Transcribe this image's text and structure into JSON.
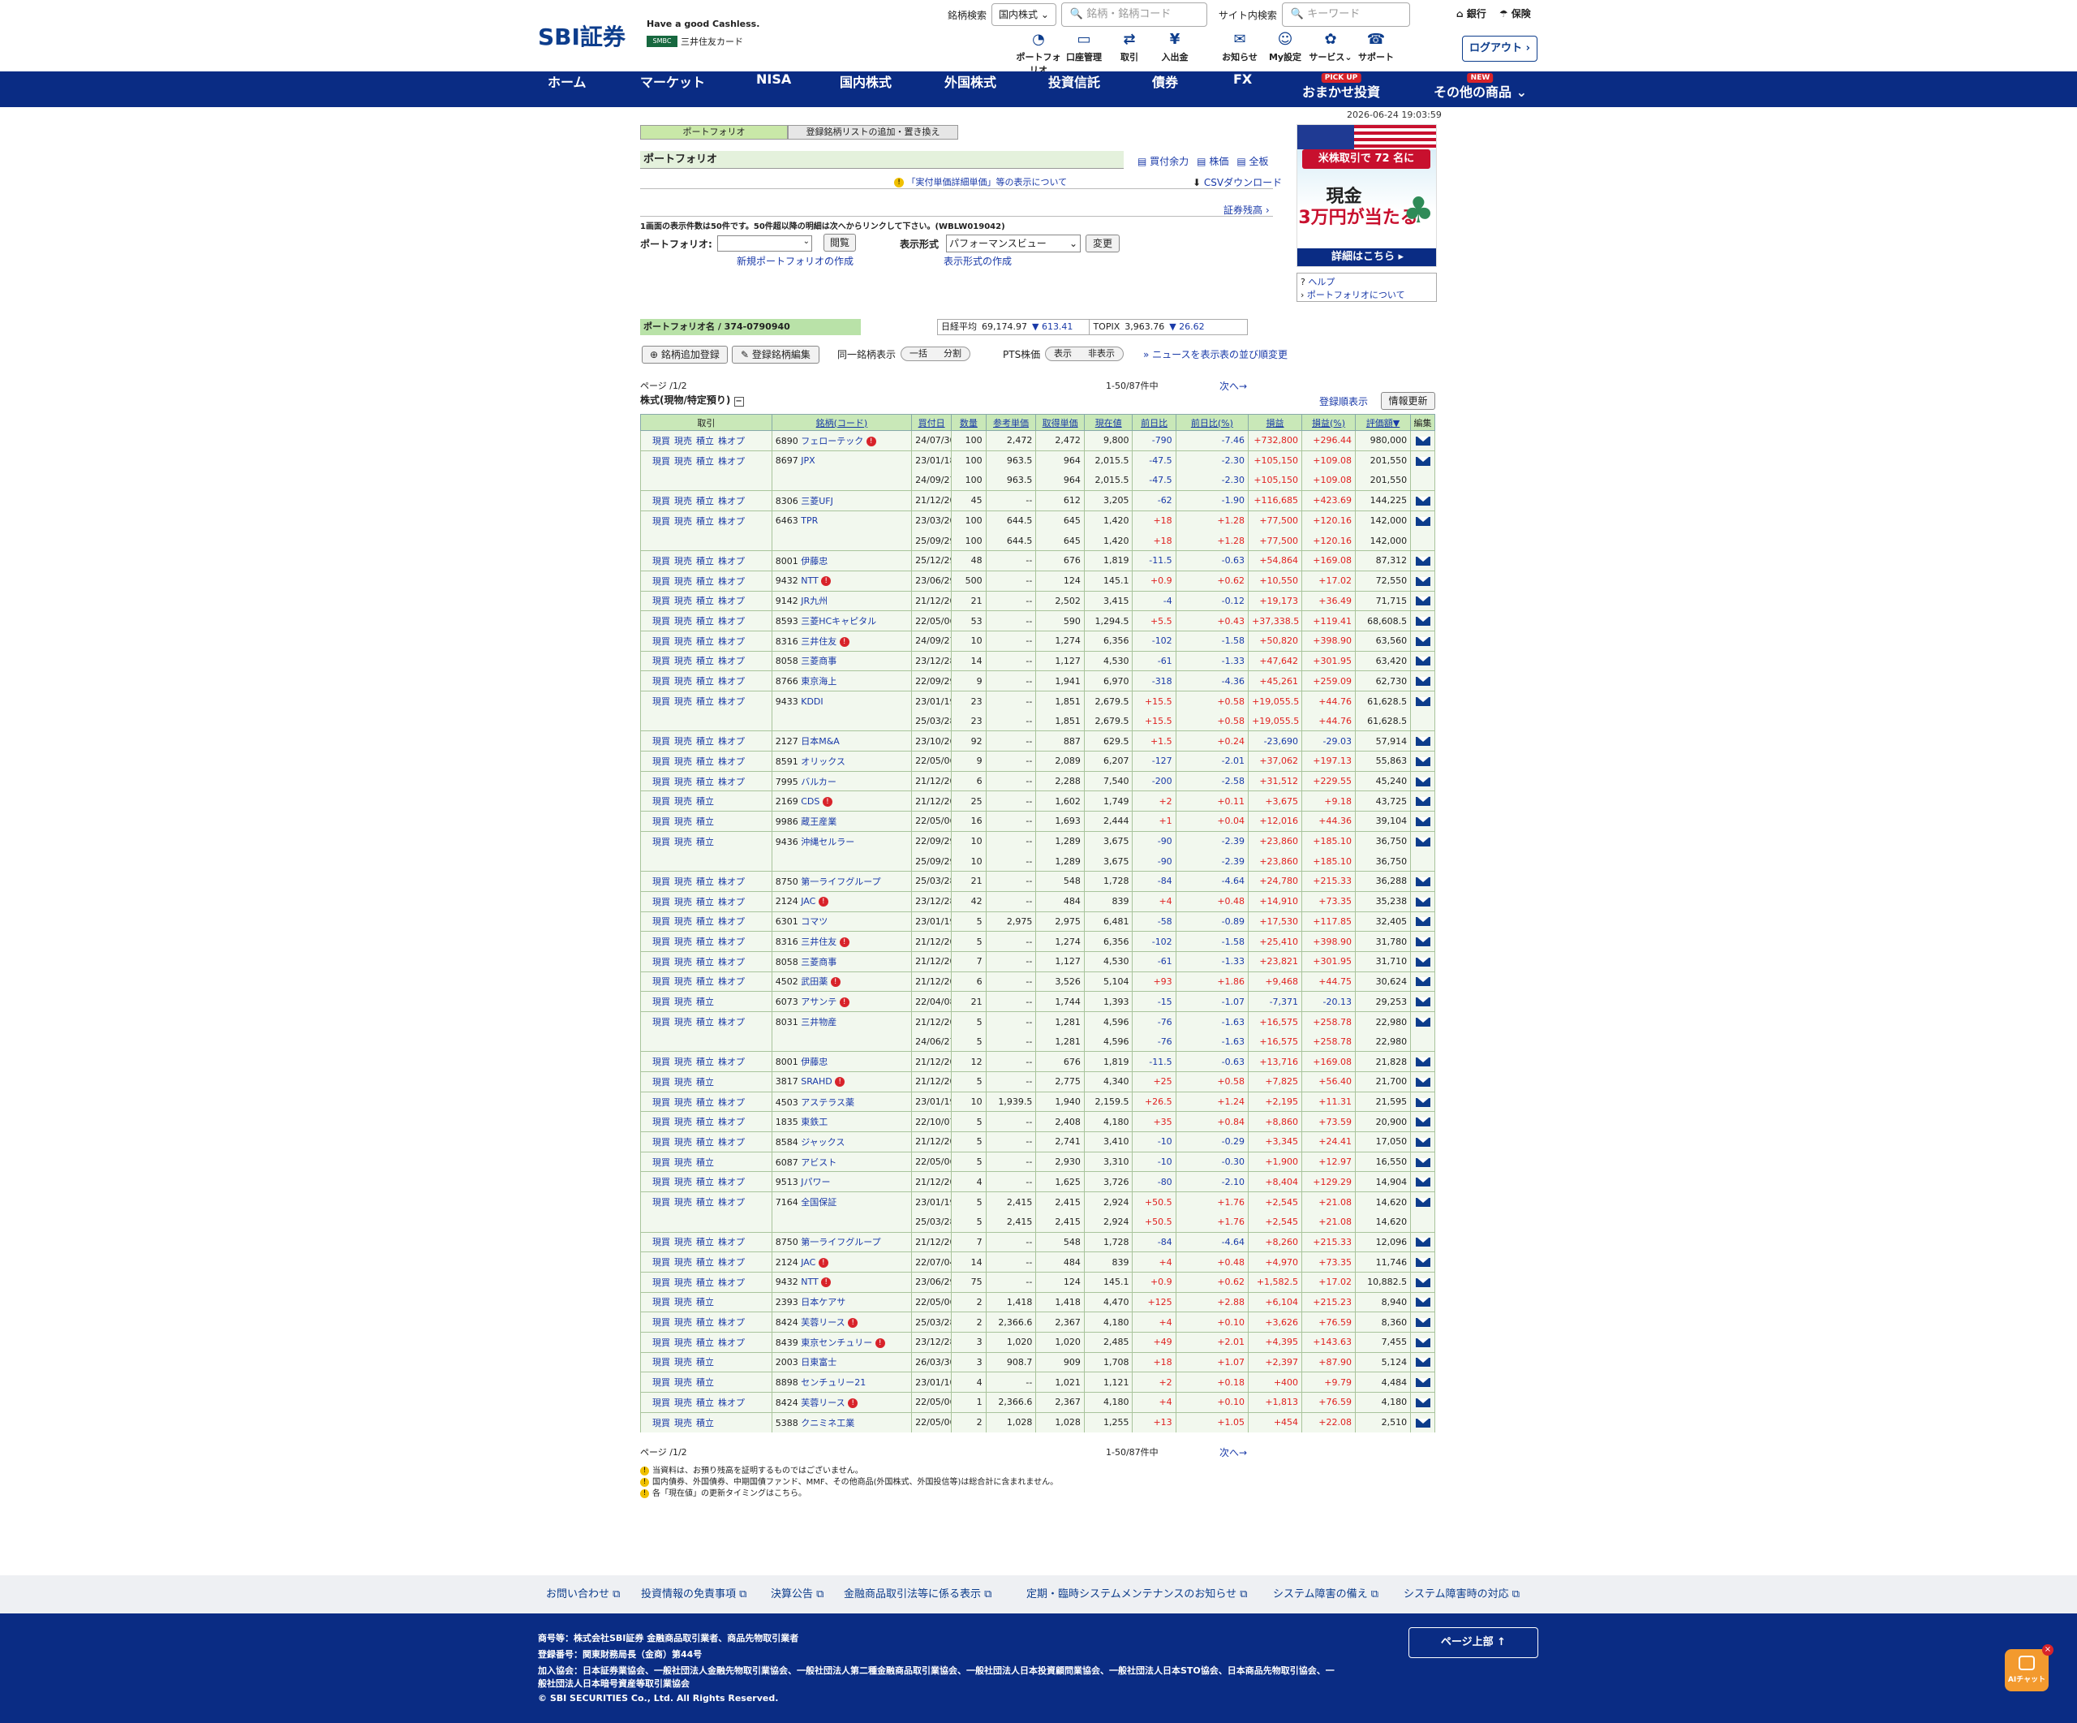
{
  "header": {
    "logo": "SBI証券",
    "tagline": "Have a good Cashless.",
    "card_badge": "SMBC",
    "card_name": "三井住友カード",
    "search_label": "銘柄検索",
    "market_select": "国内株式 ⌄",
    "stock_search_placeholder": "銘柄・銘柄コード",
    "site_search_label": "サイト内検索",
    "site_search_placeholder": "キーワード",
    "bank": "銀行",
    "insurance": "保険",
    "logout": "ログアウト ›"
  },
  "icon_nav": [
    {
      "icon": "◔",
      "label": "ポートフォリオ"
    },
    {
      "icon": "▭",
      "label": "口座管理"
    },
    {
      "icon": "⇄",
      "label": "取引"
    },
    {
      "icon": "¥",
      "label": "入出金"
    },
    {
      "icon": "✉",
      "label": "お知らせ"
    },
    {
      "icon": "☺",
      "label": "My設定"
    },
    {
      "icon": "✿",
      "label": "サービス⌄"
    },
    {
      "icon": "☎",
      "label": "サポート"
    }
  ],
  "global_nav": [
    {
      "label": "ホーム",
      "badge": ""
    },
    {
      "label": "マーケット",
      "badge": ""
    },
    {
      "label": "NISA",
      "badge": ""
    },
    {
      "label": "国内株式",
      "badge": ""
    },
    {
      "label": "外国株式",
      "badge": ""
    },
    {
      "label": "投資信託",
      "badge": ""
    },
    {
      "label": "債券",
      "badge": ""
    },
    {
      "label": "FX",
      "badge": ""
    },
    {
      "label": "おまかせ投資",
      "badge": "PICK UP"
    },
    {
      "label": "その他の商品 ⌄",
      "badge": "NEW"
    }
  ],
  "timestamp": "2026-06-24 19:03:59",
  "tabs": [
    "ポートフォリオ",
    "登録銘柄リストの追加・置き換え"
  ],
  "portfolio": {
    "title": "ポートフォリオ",
    "links": [
      "買付余力",
      "株価",
      "全板"
    ],
    "info_link": "「実付単価詳細単価」等の表示について",
    "csv": "CSVダウンロード",
    "shoken": "証券残高 ›",
    "note": "1画面の表示件数は50件です。50件超以降の明細は次へからリンクして下さい。(WBLW019042)",
    "pf_label": "ポートフォリオ:",
    "open_btn": "閲覧",
    "view_label": "表示形式",
    "view_value": "パフォーマンスビュー",
    "change_btn": "変更",
    "new_pf": "新規ポートフォリオの作成",
    "view_create": "表示形式の作成",
    "pf_name": "ポートフォリオ名 / 374-0790940"
  },
  "indices": {
    "n225_label": "日経平均",
    "n225": "69,174.97",
    "n225_chg": "▼ 613.41",
    "topix_label": "TOPIX",
    "topix": "3,963.76",
    "topix_chg": "▼ 26.62"
  },
  "controls": {
    "add": "銘柄追加登録",
    "edit": "登録銘柄編集",
    "same_label": "同一銘柄表示",
    "same_a": "一括",
    "same_b": "分割",
    "pts_label": "PTS株価",
    "pts_a": "表示",
    "pts_b": "非表示",
    "news": "ニュースを表示",
    "order": "表の並び順変更"
  },
  "ad": {
    "line1": "米株取引で 72 名に",
    "line2": "現金",
    "line3": "3万円が当たる",
    "cta": "詳細はこちら ▸"
  },
  "help": {
    "help": "ヘルプ",
    "about": "ポートフォリオについて"
  },
  "paging": {
    "page": "ページ /1/2",
    "count": "1-50/87件中",
    "next": "次へ→"
  },
  "section_title": "株式(現物/特定預り)",
  "reg_order": "登録順表示",
  "refresh": "情報更新",
  "columns": [
    "取引",
    "銘柄(コード)",
    "買付日",
    "数量",
    "参考単価",
    "取得単価",
    "現在値",
    "前日比",
    "前日比(%)",
    "損益",
    "損益(%)",
    "評価額▼",
    "編集"
  ],
  "actions": [
    "現買",
    "現売",
    "積立",
    "株オプ"
  ],
  "rows": [
    [
      "1111",
      "6890",
      "フェローテック",
      "1",
      "24/07/30",
      "100",
      "2,472",
      "2,472",
      "9,800",
      "-790",
      "-7.46",
      "+732,800",
      "+296.44",
      "980,000"
    ],
    [
      "1111",
      "8697",
      "JPX",
      "0",
      "23/01/18",
      "100",
      "963.5",
      "964",
      "2,015.5",
      "-47.5",
      "-2.30",
      "+105,150",
      "+109.08",
      "201,550"
    ],
    [
      "",
      "",
      "",
      "0",
      "24/09/27",
      "100",
      "963.5",
      "964",
      "2,015.5",
      "-47.5",
      "-2.30",
      "+105,150",
      "+109.08",
      "201,550"
    ],
    [
      "1111",
      "8306",
      "三菱UFJ",
      "0",
      "21/12/20",
      "45",
      "--",
      "612",
      "3,205",
      "-62",
      "-1.90",
      "+116,685",
      "+423.69",
      "144,225"
    ],
    [
      "1111",
      "6463",
      "TPR",
      "0",
      "23/03/20",
      "100",
      "644.5",
      "645",
      "1,420",
      "+18",
      "+1.28",
      "+77,500",
      "+120.16",
      "142,000"
    ],
    [
      "",
      "",
      "",
      "0",
      "25/09/29",
      "100",
      "644.5",
      "645",
      "1,420",
      "+18",
      "+1.28",
      "+77,500",
      "+120.16",
      "142,000"
    ],
    [
      "1111",
      "8001",
      "伊藤忠",
      "0",
      "25/12/29",
      "48",
      "--",
      "676",
      "1,819",
      "-11.5",
      "-0.63",
      "+54,864",
      "+169.08",
      "87,312"
    ],
    [
      "1111",
      "9432",
      "NTT",
      "1",
      "23/06/29",
      "500",
      "--",
      "124",
      "145.1",
      "+0.9",
      "+0.62",
      "+10,550",
      "+17.02",
      "72,550"
    ],
    [
      "1111",
      "9142",
      "JR九州",
      "0",
      "21/12/20",
      "21",
      "--",
      "2,502",
      "3,415",
      "-4",
      "-0.12",
      "+19,173",
      "+36.49",
      "71,715"
    ],
    [
      "1111",
      "8593",
      "三菱HCキャピタル",
      "0",
      "22/05/06",
      "53",
      "--",
      "590",
      "1,294.5",
      "+5.5",
      "+0.43",
      "+37,338.5",
      "+119.41",
      "68,608.5"
    ],
    [
      "1111",
      "8316",
      "三井住友",
      "1",
      "24/09/27",
      "10",
      "--",
      "1,274",
      "6,356",
      "-102",
      "-1.58",
      "+50,820",
      "+398.90",
      "63,560"
    ],
    [
      "1111",
      "8058",
      "三菱商事",
      "0",
      "23/12/28",
      "14",
      "--",
      "1,127",
      "4,530",
      "-61",
      "-1.33",
      "+47,642",
      "+301.95",
      "63,420"
    ],
    [
      "1111",
      "8766",
      "東京海上",
      "0",
      "22/09/29",
      "9",
      "--",
      "1,941",
      "6,970",
      "-318",
      "-4.36",
      "+45,261",
      "+259.09",
      "62,730"
    ],
    [
      "1111",
      "9433",
      "KDDI",
      "0",
      "23/01/19",
      "23",
      "--",
      "1,851",
      "2,679.5",
      "+15.5",
      "+0.58",
      "+19,055.5",
      "+44.76",
      "61,628.5"
    ],
    [
      "",
      "",
      "",
      "0",
      "25/03/28",
      "23",
      "--",
      "1,851",
      "2,679.5",
      "+15.5",
      "+0.58",
      "+19,055.5",
      "+44.76",
      "61,628.5"
    ],
    [
      "1111",
      "2127",
      "日本M&A",
      "0",
      "23/10/26",
      "92",
      "--",
      "887",
      "629.5",
      "+1.5",
      "+0.24",
      "-23,690",
      "-29.03",
      "57,914"
    ],
    [
      "1111",
      "8591",
      "オリックス",
      "0",
      "22/05/06",
      "9",
      "--",
      "2,089",
      "6,207",
      "-127",
      "-2.01",
      "+37,062",
      "+197.13",
      "55,863"
    ],
    [
      "1111",
      "7995",
      "バルカー",
      "0",
      "21/12/20",
      "6",
      "--",
      "2,288",
      "7,540",
      "-200",
      "-2.58",
      "+31,512",
      "+229.55",
      "45,240"
    ],
    [
      "1110",
      "2169",
      "CDS",
      "1",
      "21/12/20",
      "25",
      "--",
      "1,602",
      "1,749",
      "+2",
      "+0.11",
      "+3,675",
      "+9.18",
      "43,725"
    ],
    [
      "1110",
      "9986",
      "蔵王産業",
      "0",
      "22/05/06",
      "16",
      "--",
      "1,693",
      "2,444",
      "+1",
      "+0.04",
      "+12,016",
      "+44.36",
      "39,104"
    ],
    [
      "1110",
      "9436",
      "沖縄セルラー",
      "0",
      "22/09/29",
      "10",
      "--",
      "1,289",
      "3,675",
      "-90",
      "-2.39",
      "+23,860",
      "+185.10",
      "36,750"
    ],
    [
      "",
      "",
      "",
      "0",
      "25/09/29",
      "10",
      "--",
      "1,289",
      "3,675",
      "-90",
      "-2.39",
      "+23,860",
      "+185.10",
      "36,750"
    ],
    [
      "1111",
      "8750",
      "第一ライフグループ",
      "0",
      "25/03/28",
      "21",
      "--",
      "548",
      "1,728",
      "-84",
      "-4.64",
      "+24,780",
      "+215.33",
      "36,288"
    ],
    [
      "1111",
      "2124",
      "JAC",
      "1",
      "23/12/28",
      "42",
      "--",
      "484",
      "839",
      "+4",
      "+0.48",
      "+14,910",
      "+73.35",
      "35,238"
    ],
    [
      "1111",
      "6301",
      "コマツ",
      "0",
      "23/01/19",
      "5",
      "2,975",
      "2,975",
      "6,481",
      "-58",
      "-0.89",
      "+17,530",
      "+117.85",
      "32,405"
    ],
    [
      "1111",
      "8316",
      "三井住友",
      "1",
      "21/12/20",
      "5",
      "--",
      "1,274",
      "6,356",
      "-102",
      "-1.58",
      "+25,410",
      "+398.90",
      "31,780"
    ],
    [
      "1111",
      "8058",
      "三菱商事",
      "0",
      "21/12/20",
      "7",
      "--",
      "1,127",
      "4,530",
      "-61",
      "-1.33",
      "+23,821",
      "+301.95",
      "31,710"
    ],
    [
      "1111",
      "4502",
      "武田薬",
      "1",
      "21/12/20",
      "6",
      "--",
      "3,526",
      "5,104",
      "+93",
      "+1.86",
      "+9,468",
      "+44.75",
      "30,624"
    ],
    [
      "1110",
      "6073",
      "アサンテ",
      "1",
      "22/04/08",
      "21",
      "--",
      "1,744",
      "1,393",
      "-15",
      "-1.07",
      "-7,371",
      "-20.13",
      "29,253"
    ],
    [
      "1111",
      "8031",
      "三井物産",
      "0",
      "21/12/20",
      "5",
      "--",
      "1,281",
      "4,596",
      "-76",
      "-1.63",
      "+16,575",
      "+258.78",
      "22,980"
    ],
    [
      "",
      "",
      "",
      "0",
      "24/06/27",
      "5",
      "--",
      "1,281",
      "4,596",
      "-76",
      "-1.63",
      "+16,575",
      "+258.78",
      "22,980"
    ],
    [
      "1111",
      "8001",
      "伊藤忠",
      "0",
      "21/12/20",
      "12",
      "--",
      "676",
      "1,819",
      "-11.5",
      "-0.63",
      "+13,716",
      "+169.08",
      "21,828"
    ],
    [
      "1110",
      "3817",
      "SRAHD",
      "1",
      "21/12/20",
      "5",
      "--",
      "2,775",
      "4,340",
      "+25",
      "+0.58",
      "+7,825",
      "+56.40",
      "21,700"
    ],
    [
      "1111",
      "4503",
      "アステラス薬",
      "0",
      "23/01/19",
      "10",
      "1,939.5",
      "1,940",
      "2,159.5",
      "+26.5",
      "+1.24",
      "+2,195",
      "+11.31",
      "21,595"
    ],
    [
      "1111",
      "1835",
      "東鉄工",
      "0",
      "22/10/07",
      "5",
      "--",
      "2,408",
      "4,180",
      "+35",
      "+0.84",
      "+8,860",
      "+73.59",
      "20,900"
    ],
    [
      "1111",
      "8584",
      "ジャックス",
      "0",
      "21/12/20",
      "5",
      "--",
      "2,741",
      "3,410",
      "-10",
      "-0.29",
      "+3,345",
      "+24.41",
      "17,050"
    ],
    [
      "1110",
      "6087",
      "アビスト",
      "0",
      "22/05/06",
      "5",
      "--",
      "2,930",
      "3,310",
      "-10",
      "-0.30",
      "+1,900",
      "+12.97",
      "16,550"
    ],
    [
      "1111",
      "9513",
      "Jパワー",
      "0",
      "21/12/20",
      "4",
      "--",
      "1,625",
      "3,726",
      "-80",
      "-2.10",
      "+8,404",
      "+129.29",
      "14,904"
    ],
    [
      "1111",
      "7164",
      "全国保証",
      "0",
      "23/01/19",
      "5",
      "2,415",
      "2,415",
      "2,924",
      "+50.5",
      "+1.76",
      "+2,545",
      "+21.08",
      "14,620"
    ],
    [
      "",
      "",
      "",
      "0",
      "25/03/28",
      "5",
      "2,415",
      "2,415",
      "2,924",
      "+50.5",
      "+1.76",
      "+2,545",
      "+21.08",
      "14,620"
    ],
    [
      "1111",
      "8750",
      "第一ライフグループ",
      "0",
      "21/12/20",
      "7",
      "--",
      "548",
      "1,728",
      "-84",
      "-4.64",
      "+8,260",
      "+215.33",
      "12,096"
    ],
    [
      "1111",
      "2124",
      "JAC",
      "1",
      "22/07/04",
      "14",
      "--",
      "484",
      "839",
      "+4",
      "+0.48",
      "+4,970",
      "+73.35",
      "11,746"
    ],
    [
      "1111",
      "9432",
      "NTT",
      "1",
      "23/06/29",
      "75",
      "--",
      "124",
      "145.1",
      "+0.9",
      "+0.62",
      "+1,582.5",
      "+17.02",
      "10,882.5"
    ],
    [
      "1110",
      "2393",
      "日本ケアサ",
      "0",
      "22/05/06",
      "2",
      "1,418",
      "1,418",
      "4,470",
      "+125",
      "+2.88",
      "+6,104",
      "+215.23",
      "8,940"
    ],
    [
      "1111",
      "8424",
      "芙蓉リース",
      "1",
      "25/03/28",
      "2",
      "2,366.6",
      "2,367",
      "4,180",
      "+4",
      "+0.10",
      "+3,626",
      "+76.59",
      "8,360"
    ],
    [
      "1111",
      "8439",
      "東京センチュリー",
      "1",
      "23/12/28",
      "3",
      "1,020",
      "1,020",
      "2,485",
      "+49",
      "+2.01",
      "+4,395",
      "+143.63",
      "7,455"
    ],
    [
      "1110",
      "2003",
      "日東富士",
      "0",
      "26/03/30",
      "3",
      "908.7",
      "909",
      "1,708",
      "+18",
      "+1.07",
      "+2,397",
      "+87.90",
      "5,124"
    ],
    [
      "1110",
      "8898",
      "センチュリー21",
      "0",
      "23/01/10",
      "4",
      "--",
      "1,021",
      "1,121",
      "+2",
      "+0.18",
      "+400",
      "+9.79",
      "4,484"
    ],
    [
      "1111",
      "8424",
      "芙蓉リース",
      "1",
      "22/05/06",
      "1",
      "2,366.6",
      "2,367",
      "4,180",
      "+4",
      "+0.10",
      "+1,813",
      "+76.59",
      "4,180"
    ],
    [
      "1110",
      "5388",
      "クニミネ工業",
      "0",
      "22/05/06",
      "2",
      "1,028",
      "1,028",
      "1,255",
      "+13",
      "+1.05",
      "+454",
      "+22.08",
      "2,510"
    ]
  ],
  "notes": [
    "当資料は、お預り残高を証明するものではございません。",
    "国内債券、外国債券、中期国債ファンド、MMF、その他商品(外国株式、外国投信等)は総合計に含まれません。",
    "各「現在値」の更新タイミングはこちら。"
  ],
  "footer_links": [
    "お問い合わせ ⧉",
    "投資情報の免責事項 ⧉",
    "決算公告 ⧉",
    "金融商品取引法等に係る表示 ⧉",
    "定期・臨時システムメンテナンスのお知らせ ⧉",
    "システム障害の備え ⧉",
    "システム障害時の対応 ⧉"
  ],
  "footer": {
    "line1": "商号等：株式会社SBI証券 金融商品取引業者、商品先物取引業者",
    "line2": "登録番号：関東財務局長（金商）第44号",
    "line3": "加入協会：日本証券業協会、一般社団法人金融先物取引業協会、一般社団法人第二種金融商品取引業協会、一般社団法人日本投資顧問業協会、一般社団法人日本STO協会、日本商品先物取引協会、一",
    "line4": "般社団法人日本暗号資産等取引業協会",
    "copyright": "© SBI SECURITIES Co., Ltd. All Rights Reserved.",
    "pagetop": "ページ上部 ↑"
  },
  "ai_chat": "AIチャット"
}
